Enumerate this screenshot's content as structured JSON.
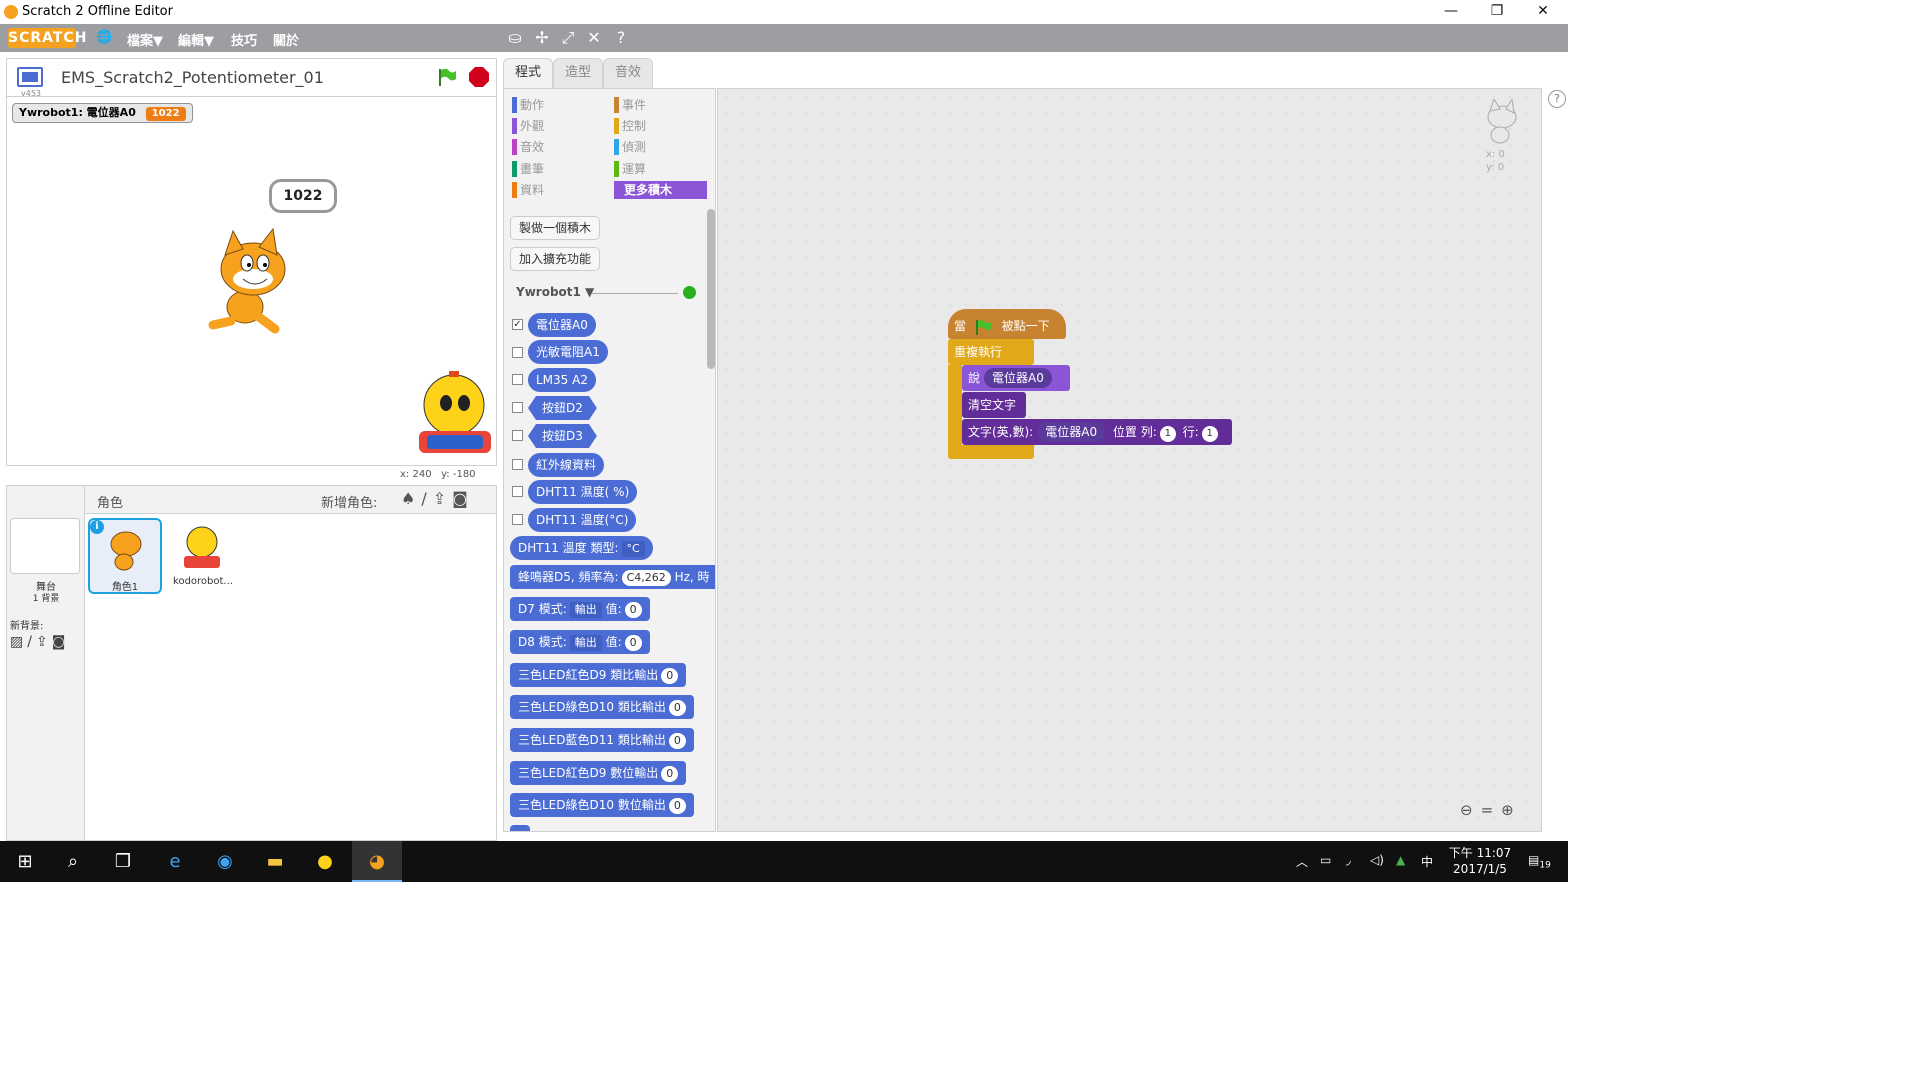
{
  "window": {
    "title": "Scratch 2 Offline Editor",
    "min": "—",
    "max": "❐",
    "close": "✕"
  },
  "menubar": {
    "logo": "SCRATCH",
    "file": "檔案▼",
    "edit": "編輯▼",
    "tips": "技巧",
    "about": "關於"
  },
  "stage": {
    "project_title": "EMS_Scratch2_Potentiometer_01",
    "version": "v453",
    "monitor_label": "Ywrobot1: 電位器A0",
    "monitor_value": "1022",
    "speech": "1022",
    "coords_x": "x: 240",
    "coords_y": "y: -180"
  },
  "sprites": {
    "header": "角色",
    "new_sprite": "新增角色:",
    "stage_label": "舞台",
    "stage_sub": "1 背景",
    "new_backdrop": "新背景:",
    "items": [
      {
        "name": "角色1"
      },
      {
        "name": "kodorobot..."
      }
    ]
  },
  "tabs": [
    {
      "label": "程式"
    },
    {
      "label": "造型"
    },
    {
      "label": "音效"
    }
  ],
  "categories": {
    "left": [
      {
        "label": "動作",
        "color": "#4a6cd4"
      },
      {
        "label": "外觀",
        "color": "#8a55d7"
      },
      {
        "label": "音效",
        "color": "#bb42c3"
      },
      {
        "label": "畫筆",
        "color": "#0e9a6c"
      },
      {
        "label": "資料",
        "color": "#ee7d16"
      }
    ],
    "right": [
      {
        "label": "事件",
        "color": "#c88330"
      },
      {
        "label": "控制",
        "color": "#e1a91a"
      },
      {
        "label": "偵測",
        "color": "#2ca5e2"
      },
      {
        "label": "運算",
        "color": "#5cb712"
      },
      {
        "label": "更多積木",
        "color": "#632d99"
      }
    ]
  },
  "palette": {
    "make_block": "製做一個積木",
    "add_extension": "加入擴充功能",
    "extension_name": "Ywrobot1 ▼",
    "blocks": [
      {
        "label": "電位器A0",
        "checked": true
      },
      {
        "label": "光敏電阻A1",
        "checked": false
      },
      {
        "label": "LM35  A2",
        "checked": false
      },
      {
        "label": "按鈕D2",
        "checked": false
      },
      {
        "label": "按鈕D3",
        "checked": false
      },
      {
        "label": "紅外線資料",
        "checked": false
      },
      {
        "label": "DHT11 濕度( %)",
        "checked": false
      },
      {
        "label": "DHT11 溫度(°C)",
        "checked": false
      }
    ],
    "dht_type": {
      "label": "DHT11 溫度 類型:",
      "value": "°C"
    },
    "buzzer": {
      "label": "蜂鳴器D5, 頻率為:",
      "value": "C4,262",
      "unit": "Hz, 時"
    },
    "d7": {
      "label": "D7 模式:",
      "mode": "輸出",
      "val_label": "值:",
      "value": "0"
    },
    "d8": {
      "label": "D8 模式:",
      "mode": "輸出",
      "val_label": "值:",
      "value": "0"
    },
    "led_blocks": [
      {
        "label": "三色LED紅色D9 類比輸出",
        "value": "0"
      },
      {
        "label": "三色LED綠色D10 類比輸出",
        "value": "0"
      },
      {
        "label": "三色LED藍色D11 類比輸出",
        "value": "0"
      },
      {
        "label": "三色LED紅色D9 數位輸出",
        "value": "0"
      },
      {
        "label": "三色LED綠色D10 數位輸出",
        "value": "0"
      }
    ]
  },
  "script": {
    "hat_when": "當",
    "hat_clicked": "被點一下",
    "forever": "重複執行",
    "say": "說",
    "say_arg": "電位器A0",
    "clear": "清空文字",
    "text_block": "文字(英,數):",
    "text_arg": "電位器A0",
    "pos": "位置 列:",
    "row": "1",
    "col_label": "行:",
    "col": "1"
  },
  "sprite_info": {
    "x": "x: 0",
    "y": "y: 0"
  },
  "taskbar": {
    "time": "下午 11:07",
    "date": "2017/1/5",
    "ime": "中",
    "notifications": "19"
  }
}
